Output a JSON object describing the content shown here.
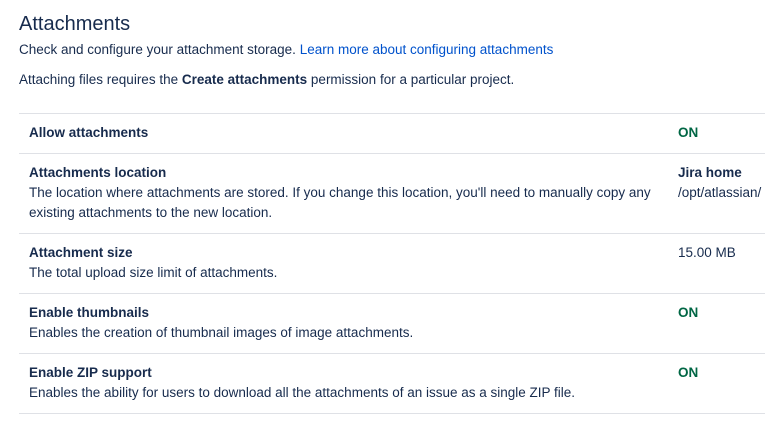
{
  "header": {
    "title": "Attachments",
    "intro_text": "Check and configure your attachment storage.",
    "learn_more_link": "Learn more about configuring attachments",
    "permission_pre": "Attaching files requires the",
    "permission_bold": "Create attachments",
    "permission_post": "permission for a particular project."
  },
  "settings": [
    {
      "name": "Allow attachments",
      "description": "",
      "value": "ON",
      "value_type": "on"
    },
    {
      "name": "Attachments location",
      "description": "The location where attachments are stored. If you change this location, you'll need to manually copy any existing attachments to the new location.",
      "value": "Jira home",
      "value_detail": "/opt/atlassian/",
      "value_type": "text"
    },
    {
      "name": "Attachment size",
      "description": "The total upload size limit of attachments.",
      "value": "15.00 MB",
      "value_type": "plain"
    },
    {
      "name": "Enable thumbnails",
      "description": "Enables the creation of thumbnail images of image attachments.",
      "value": "ON",
      "value_type": "on"
    },
    {
      "name": "Enable ZIP support",
      "description": "Enables the ability for users to download all the attachments of an issue as a single ZIP file.",
      "value": "ON",
      "value_type": "on"
    }
  ],
  "colors": {
    "text": "#172b4d",
    "link": "#0052cc",
    "on": "#006644",
    "border": "#dfe1e6"
  }
}
